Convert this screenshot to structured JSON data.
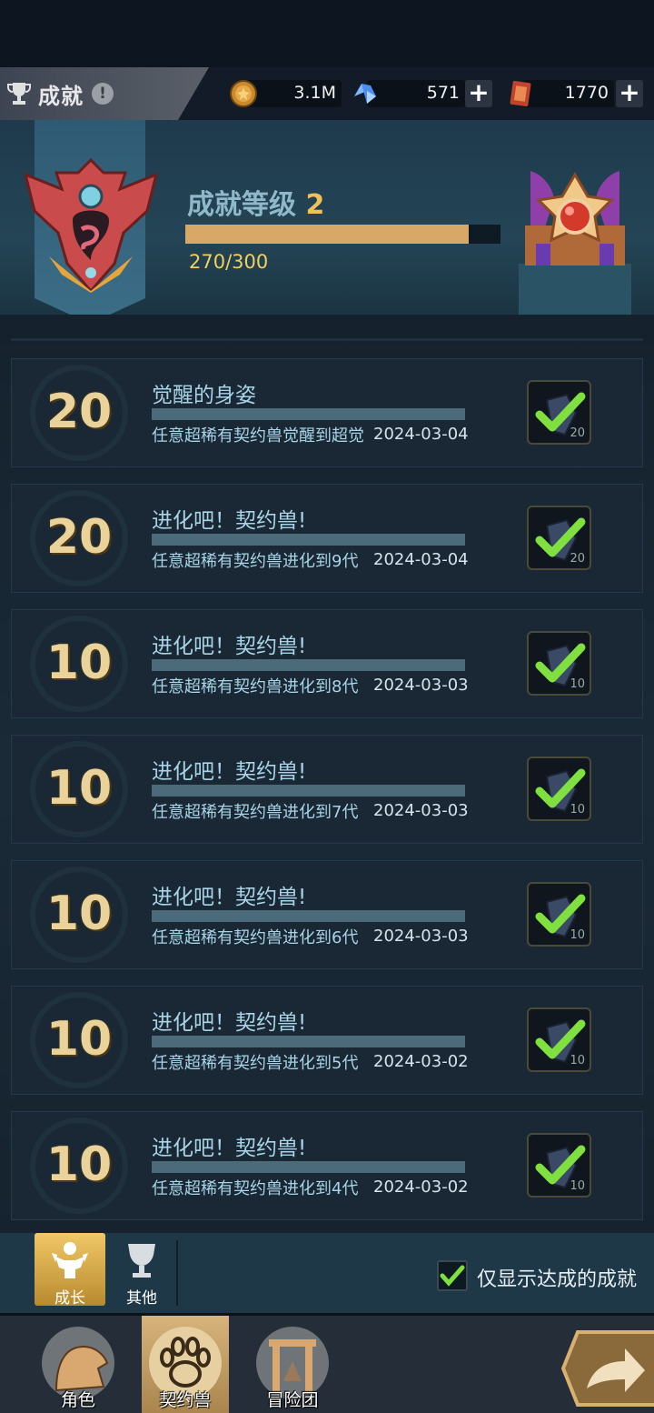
{
  "header": {
    "title": "成就",
    "info": "!"
  },
  "currencies": [
    {
      "name": "gold",
      "value": "3.1M",
      "has_plus": false
    },
    {
      "name": "crystal",
      "value": "571",
      "has_plus": true
    },
    {
      "name": "ticket",
      "value": "1770",
      "has_plus": true
    }
  ],
  "level": {
    "label": "成就等级",
    "value": "2",
    "progress_text": "270/300",
    "progress_fraction": 0.9
  },
  "achievements": [
    {
      "points": "20",
      "name": "觉醒的身姿",
      "desc": "任意超稀有契约兽觉醒到超觉",
      "date": "2024-03-04",
      "badge": "20"
    },
    {
      "points": "20",
      "name": "进化吧！契约兽!",
      "desc": "任意超稀有契约兽进化到9代",
      "date": "2024-03-04",
      "badge": "20"
    },
    {
      "points": "10",
      "name": "进化吧！契约兽!",
      "desc": "任意超稀有契约兽进化到8代",
      "date": "2024-03-03",
      "badge": "10"
    },
    {
      "points": "10",
      "name": "进化吧！契约兽!",
      "desc": "任意超稀有契约兽进化到7代",
      "date": "2024-03-03",
      "badge": "10"
    },
    {
      "points": "10",
      "name": "进化吧！契约兽!",
      "desc": "任意超稀有契约兽进化到6代",
      "date": "2024-03-03",
      "badge": "10"
    },
    {
      "points": "10",
      "name": "进化吧！契约兽!",
      "desc": "任意超稀有契约兽进化到5代",
      "date": "2024-03-02",
      "badge": "10"
    },
    {
      "points": "10",
      "name": "进化吧！契约兽!",
      "desc": "任意超稀有契约兽进化到4代",
      "date": "2024-03-02",
      "badge": "10"
    }
  ],
  "tabs": {
    "growth": "成长",
    "other": "其他"
  },
  "filter": {
    "label": "仅显示达成的成就",
    "checked": true
  },
  "nav": [
    {
      "label": "角色",
      "active": false
    },
    {
      "label": "契约兽",
      "active": true
    },
    {
      "label": "冒险团",
      "active": false
    }
  ]
}
